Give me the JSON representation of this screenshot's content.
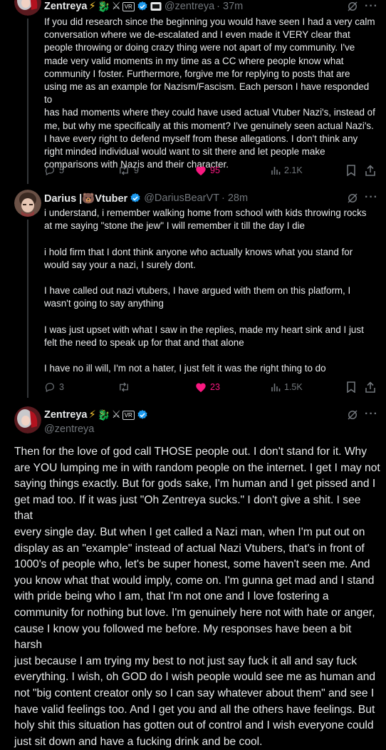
{
  "tweet1": {
    "name": "Zentreya",
    "badges": [
      "⚡",
      "🐉",
      "⚔",
      "VR"
    ],
    "handle": "@zentreya",
    "time": "· 37m",
    "text": "If you did research since the beginning you would have seen I had a very calm\nconversation where we de-escalated and I even made it VERY clear that\npeople throwing or doing crazy thing were not apart of my community. I've\nmade very valid moments in my time as a CC where people know what\ncommunity I foster. Furthermore, forgive me for replying to posts that are\nusing me as an example for Nazism/Fascism. Each person I have responded to\nhas had moments where they could have used actual Vtuber Nazi's, instead of\nme, but why me specifically at this moment? I've genuinely seen actual Nazi's.\nI have every right to defend myself from these allegations. I don't think any\nright minded individual would want to sit there and let people make\ncomparisons with Nazis and their character.",
    "replies": "5",
    "reposts": "9",
    "likes": "95",
    "views": "2.1K"
  },
  "tweet2": {
    "name": "Darius |🐻Vtuber",
    "handle": "@DariusBearVT",
    "time": "· 28m",
    "text": "i understand, i remember walking home from school with kids throwing rocks\nat me saying \"stone the jew\" I will remember it till the day I die\n\ni hold firm that I dont think anyone who actually knows what you stand for\nwould say your a nazi, I surely dont.\n\nI have called out nazi vtubers, I have argued with them on this platform, I\nwasn't going to say anything\n\nI was just upset with what I saw in the replies, made my heart sink and I just\nfelt the need to speak up for that and that alone\n\nI have no ill will, I'm not a hater, I just felt it was the right thing to do",
    "replies": "3",
    "reposts": "",
    "likes": "23",
    "views": "1.5K"
  },
  "tweet3": {
    "name": "Zentreya",
    "badges": [
      "⚡",
      "🐉",
      "⚔",
      "VR"
    ],
    "handle": "@zentreya",
    "text": "Then for the love of god call THOSE people out. I don't stand for it. Why\nare YOU lumping me in with random people on the internet. I get I may not\nsaying things exactly. But for gods sake, I'm human and I get pissed and I\nget mad too. If it was just \"Oh Zentreya sucks.\" I don't give a shit. I see that\nevery single day. But when I get called a Nazi man, when I'm put out on\ndisplay as an \"example\" instead of actual Nazi Vtubers, that's in front of\n1000's of people who, let's be super honest, some haven't seen me. And\nyou know what that would imply, come on. I'm gunna get mad and I stand\nwith pride being who I am, that I'm not one and I love fostering a\ncommunity for nothing but love. I'm genuinely here not with hate or anger,\ncause I know you followed me before. My responses have been a bit harsh\njust because I am trying my best to not just say fuck it all and say fuck\neverything. I wish, oh GOD do I wish people would see me as human and\nnot \"big content creator only so I can say whatever about them\" and see I\nhave valid feelings too. And I get you and all the others have feelings. But\nholy shit this situation has gotten out of control and I wish everyone could\njust sit down and have a fucking drink and be cool."
  },
  "icons": {
    "reply": "reply-icon",
    "repost": "repost-icon",
    "like": "heart-icon",
    "views": "views-icon",
    "bookmark": "bookmark-icon",
    "share": "share-icon",
    "grok": "grok-icon",
    "more": "more-icon",
    "verified": "verified-badge-icon"
  },
  "colors": {
    "background": "#000000",
    "text": "#e7e9ea",
    "muted": "#71767b",
    "like_active": "#f91880",
    "verified": "#1d9bf0"
  }
}
